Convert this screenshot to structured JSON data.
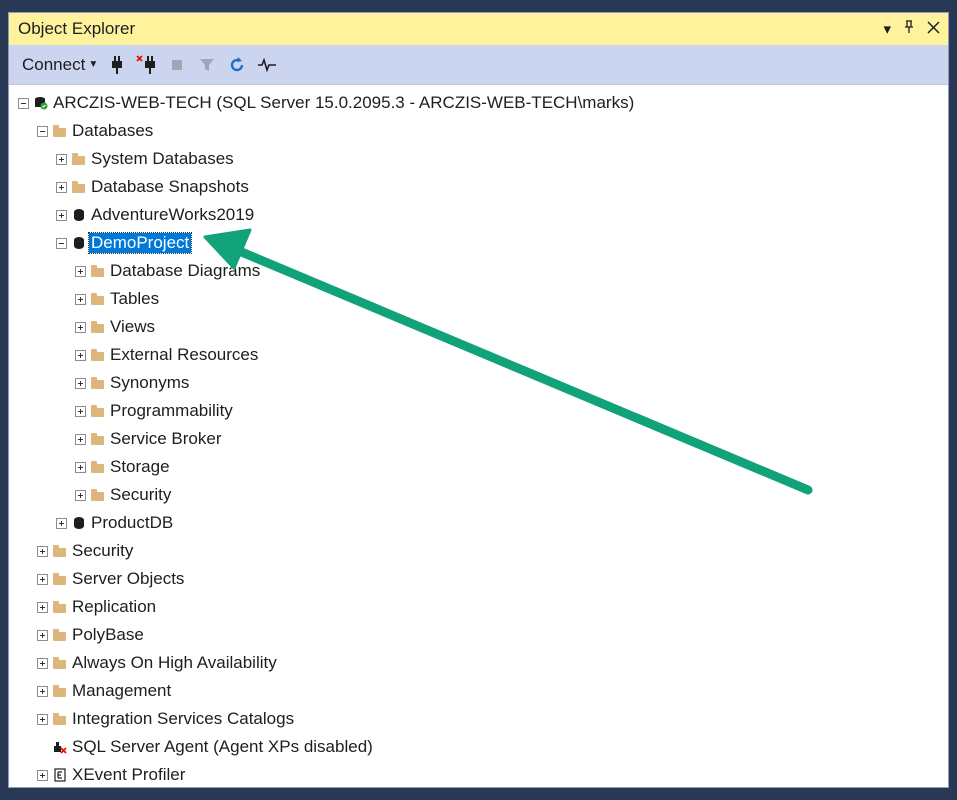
{
  "window": {
    "title": "Object Explorer"
  },
  "toolbar": {
    "connect_label": "Connect"
  },
  "tree": {
    "server": "ARCZIS-WEB-TECH (SQL Server 15.0.2095.3 - ARCZIS-WEB-TECH\\marks)",
    "databases": "Databases",
    "system_databases": "System Databases",
    "database_snapshots": "Database Snapshots",
    "adventureworks": "AdventureWorks2019",
    "demoproject": "DemoProject",
    "demo_children": [
      "Database Diagrams",
      "Tables",
      "Views",
      "External Resources",
      "Synonyms",
      "Programmability",
      "Service Broker",
      "Storage",
      "Security"
    ],
    "productdb": "ProductDB",
    "server_children": [
      "Security",
      "Server Objects",
      "Replication",
      "PolyBase",
      "Always On High Availability",
      "Management",
      "Integration Services Catalogs"
    ],
    "sql_agent": "SQL Server Agent (Agent XPs disabled)",
    "xevent": "XEvent Profiler"
  },
  "colors": {
    "title_bar": "#fff29d",
    "toolbar": "#ccd5f0",
    "selection": "#0078d7",
    "arrow": "#12a27a",
    "frame": "#293955"
  }
}
